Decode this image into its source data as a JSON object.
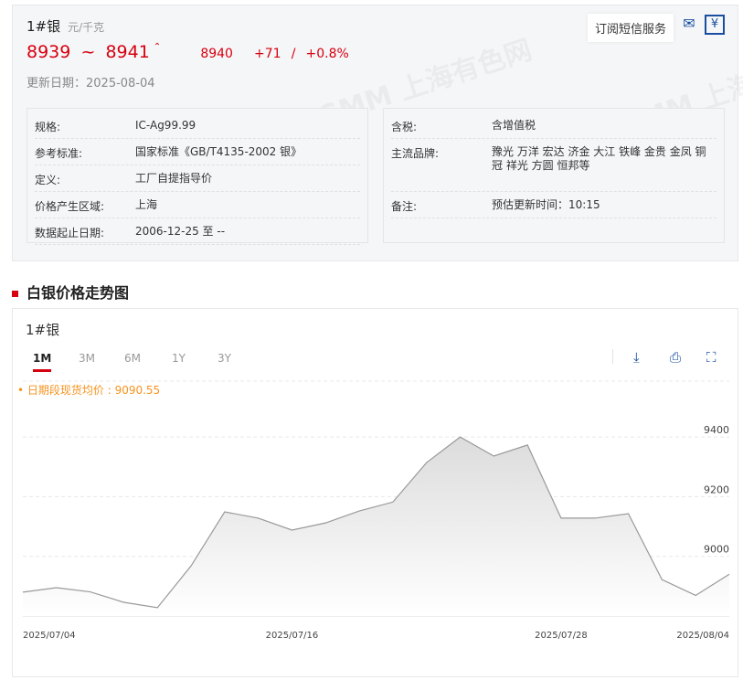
{
  "header": {
    "title": "1#银",
    "unit": "元/千克",
    "price_low": "8939",
    "tilde": "~",
    "price_high": "8941",
    "avg": "8940",
    "change": "+71",
    "slash": "/",
    "change_pct": "+0.8%",
    "update": "更新日期：2025-08-04",
    "subscribe": "订阅短信服务"
  },
  "watermark": "SMM 上海有色网",
  "left_table": [
    {
      "k": "规格:",
      "v": "IC-Ag99.99"
    },
    {
      "k": "参考标准:",
      "v": "国家标准《GB/T4135-2002 银》"
    },
    {
      "k": "定义:",
      "v": "工厂自提指导价"
    },
    {
      "k": "价格产生区域:",
      "v": "上海"
    },
    {
      "k": "数据起止日期:",
      "v": "2006-12-25 至 --"
    }
  ],
  "right_table": [
    {
      "k": "含税:",
      "v": "含增值税"
    },
    {
      "k": "主流品牌:",
      "v": "豫光 万洋 宏达 济金 大江 铁峰 金贵 金凤 铜冠 祥光 方圆 恒邦等"
    },
    {
      "k": "备注:",
      "v": "预估更新时间：10:15"
    }
  ],
  "section_title": "白银价格走势图",
  "chart_title": "1#银",
  "tabs": [
    "1M",
    "3M",
    "6M",
    "1Y",
    "3Y"
  ],
  "avg_label": "• 日期段现货均价 : 9090.55",
  "chart_data": {
    "type": "area",
    "title": "1#银",
    "ylim": [
      8800,
      9450
    ],
    "yticks": [
      8800,
      9000,
      9200,
      9400
    ],
    "x": [
      "2025/07/04",
      "2025/07/07",
      "2025/07/08",
      "2025/07/09",
      "2025/07/10",
      "2025/07/11",
      "2025/07/14",
      "2025/07/15",
      "2025/07/16",
      "2025/07/17",
      "2025/07/18",
      "2025/07/21",
      "2025/07/22",
      "2025/07/23",
      "2025/07/24",
      "2025/07/25",
      "2025/07/28",
      "2025/07/29",
      "2025/07/30",
      "2025/07/31",
      "2025/08/01",
      "2025/08/04"
    ],
    "values": [
      8880,
      8895,
      8881,
      8846,
      8828,
      8968,
      9149,
      9128,
      9088,
      9112,
      9152,
      9182,
      9314,
      9400,
      9336,
      9373,
      9128,
      9128,
      9143,
      8922,
      8869,
      8940
    ],
    "xticks": [
      "2025/07/04",
      "2025/07/16",
      "2025/07/28",
      "2025/08/04"
    ]
  }
}
